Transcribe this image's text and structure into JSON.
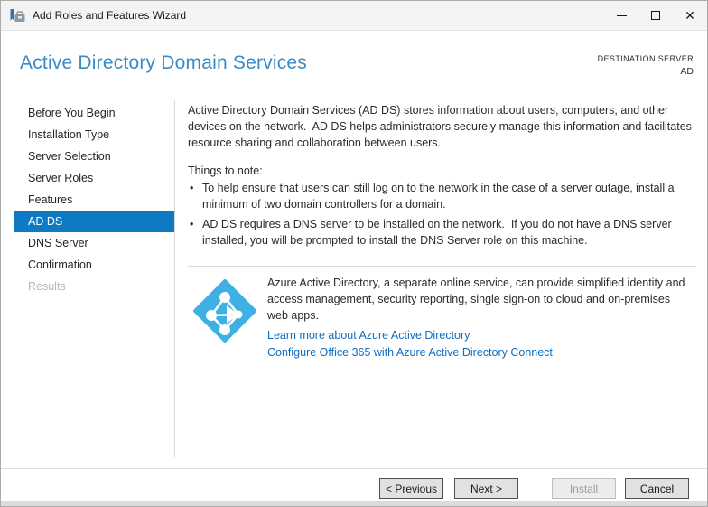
{
  "window": {
    "title": "Add Roles and Features Wizard",
    "controls": {
      "minimize": "",
      "maximize": "",
      "close": "✕"
    }
  },
  "header": {
    "title": "Active Directory Domain Services",
    "destination": {
      "label": "DESTINATION SERVER",
      "value": "AD"
    }
  },
  "sidebar": {
    "items": [
      {
        "label": "Before You Begin",
        "state": "normal"
      },
      {
        "label": "Installation Type",
        "state": "normal"
      },
      {
        "label": "Server Selection",
        "state": "normal"
      },
      {
        "label": "Server Roles",
        "state": "normal"
      },
      {
        "label": "Features",
        "state": "normal"
      },
      {
        "label": "AD DS",
        "state": "selected"
      },
      {
        "label": "DNS Server",
        "state": "normal"
      },
      {
        "label": "Confirmation",
        "state": "normal"
      },
      {
        "label": "Results",
        "state": "disabled"
      }
    ]
  },
  "content": {
    "intro": "Active Directory Domain Services (AD DS) stores information about users, computers, and other devices on the network.  AD DS helps administrators securely manage this information and facilitates resource sharing and collaboration between users.",
    "things_to_note": "Things to note:",
    "bullet_glyph": "•",
    "bullets": [
      "To help ensure that users can still log on to the network in the case of a server outage, install a minimum of two domain controllers for a domain.",
      "AD DS requires a DNS server to be installed on the network.  If you do not have a DNS server installed, you will be prompted to install the DNS Server role on this machine."
    ],
    "azure": {
      "description": "Azure Active Directory, a separate online service, can provide simplified identity and access management, security reporting, single sign-on to cloud and on-premises web apps.",
      "links": [
        "Learn more about Azure Active Directory",
        "Configure Office 365 with Azure Active Directory Connect"
      ]
    }
  },
  "footer": {
    "buttons": [
      {
        "label": "< Previous",
        "enabled": true
      },
      {
        "label": "Next >",
        "enabled": true
      },
      {
        "label": "Install",
        "enabled": false
      },
      {
        "label": "Cancel",
        "enabled": true
      }
    ]
  },
  "icons": {
    "app": "server-manager-toolbox-icon",
    "azure": "azure-active-directory-icon"
  },
  "colors": {
    "sidebar_selected": "#0E7AC4",
    "page_title_blue": "#3A8AC4",
    "link_blue": "#0B6EC4",
    "azure_icon_blue": "#3FB0E4"
  }
}
